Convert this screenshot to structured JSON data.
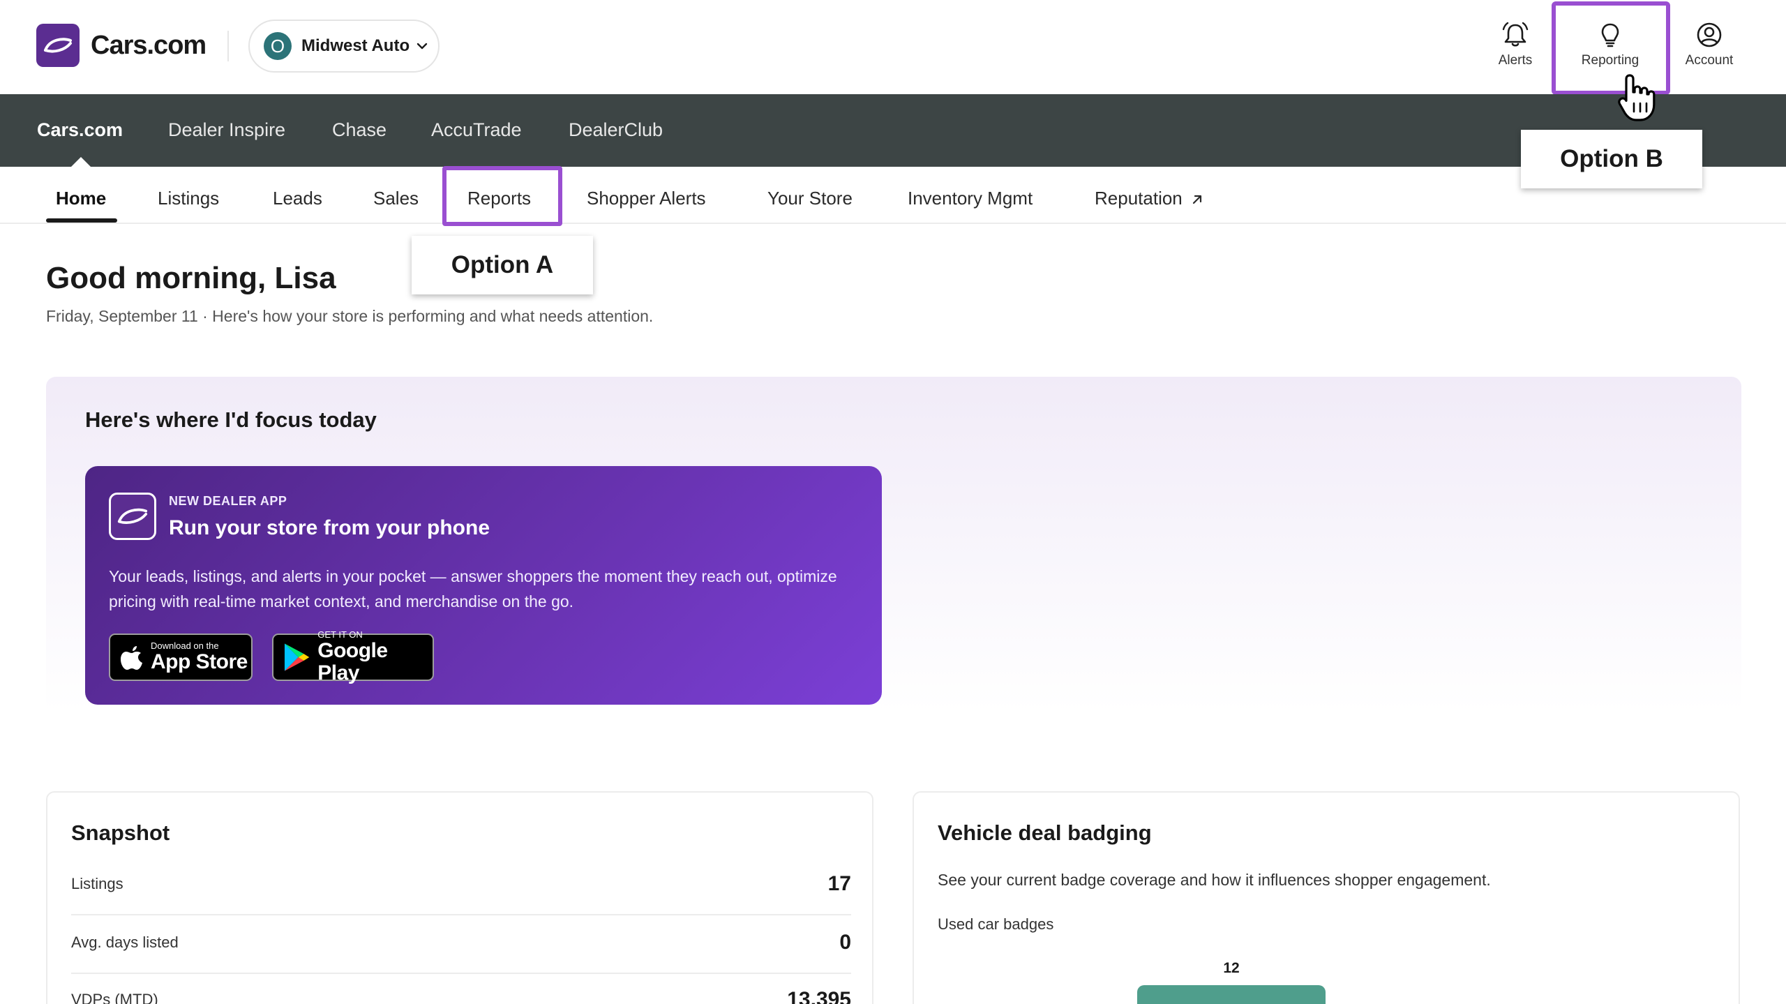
{
  "header": {
    "brand_name": "Cars.com",
    "dealer": {
      "badge": "O",
      "name": "Midwest Auto"
    },
    "icons": {
      "alerts_label": "Alerts",
      "reporting_label": "Reporting",
      "account_label": "Account"
    }
  },
  "brand_tabs": [
    {
      "label": "Cars.com",
      "active": true
    },
    {
      "label": "Dealer Inspire",
      "active": false
    },
    {
      "label": "Chase",
      "active": false
    },
    {
      "label": "AccuTrade",
      "active": false
    },
    {
      "label": "DealerClub",
      "active": false
    }
  ],
  "nav": [
    {
      "label": "Home",
      "active": true
    },
    {
      "label": "Listings",
      "active": false
    },
    {
      "label": "Leads",
      "active": false
    },
    {
      "label": "Sales",
      "active": false
    },
    {
      "label": "Reports",
      "active": false
    },
    {
      "label": "Shopper Alerts",
      "active": false
    },
    {
      "label": "Your Store",
      "active": false
    },
    {
      "label": "Inventory Mgmt",
      "active": false
    },
    {
      "label": "Reputation",
      "active": false
    }
  ],
  "options": {
    "a": "Option A",
    "b": "Option B"
  },
  "greeting": {
    "title": "Good morning, Lisa",
    "subtitle": "Friday, September 11 · Here's how your store is performing and what needs attention."
  },
  "focus": {
    "title": "Here's where I'd focus today",
    "app_card": {
      "eyebrow": "NEW DEALER APP",
      "headline": "Run your store from your phone",
      "body": "Your leads, listings, and alerts in your pocket — answer shoppers the moment they reach out, optimize pricing with real-time market context, and merchandise on the go.",
      "app_store": {
        "small": "Download on the",
        "big": "App Store"
      },
      "google_play": {
        "small": "GET IT ON",
        "big": "Google Play"
      }
    }
  },
  "snapshot": {
    "title": "Snapshot",
    "rows": [
      {
        "label": "Listings",
        "value": "17"
      },
      {
        "label": "Avg. days listed",
        "value": "0"
      },
      {
        "label": "VDPs (MTD)",
        "value": "13,395"
      }
    ]
  },
  "badging": {
    "title": "Vehicle deal badging",
    "description": "See your current badge coverage and how it influences shopper engagement.",
    "subtitle": "Used car badges",
    "bar_value": "12",
    "bar_color": "#4f9e8c"
  },
  "colors": {
    "brand_purple": "#5b2d91",
    "highlight_purple": "#9a4fd1",
    "brand_bar": "#3d4545",
    "dealer_badge": "#2c7378"
  }
}
